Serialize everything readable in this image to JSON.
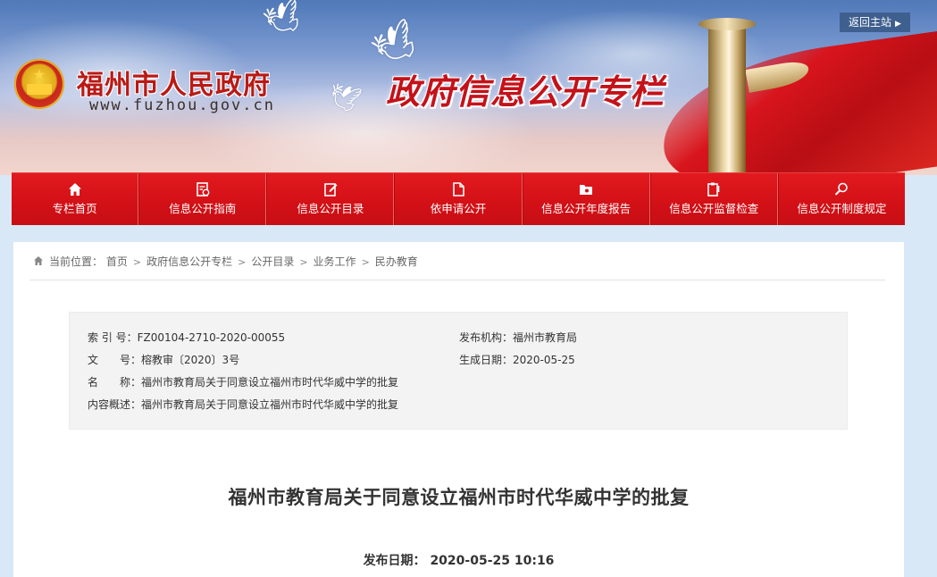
{
  "header": {
    "site_name": "福州市人民政府",
    "site_url": "www.fuzhou.gov.cn",
    "column_title": "政府信息公开专栏",
    "return_label": "返回主站"
  },
  "nav": {
    "items": [
      {
        "label": "专栏首页",
        "icon": "home-icon"
      },
      {
        "label": "信息公开指南",
        "icon": "guide-icon"
      },
      {
        "label": "信息公开目录",
        "icon": "catalog-icon"
      },
      {
        "label": "依申请公开",
        "icon": "document-icon"
      },
      {
        "label": "信息公开年度报告",
        "icon": "folder-icon"
      },
      {
        "label": "信息公开监督检查",
        "icon": "clipboard-icon"
      },
      {
        "label": "信息公开制度规定",
        "icon": "magnifier-icon"
      }
    ]
  },
  "breadcrumb": {
    "prefix": "当前位置：",
    "items": [
      "首页",
      "政府信息公开专栏",
      "公开目录",
      "业务工作",
      "民办教育"
    ],
    "separator": ">"
  },
  "meta": {
    "index_label": "索 引 号：",
    "index_value": "FZ00104-2710-2020-00055",
    "publisher_label": "发布机构：",
    "publisher_value": "福州市教育局",
    "docno_label": "文　　号：",
    "docno_value": "榕教审〔2020〕3号",
    "created_label": "生成日期：",
    "created_value": "2020-05-25",
    "name_label": "名　　称：",
    "name_value": "福州市教育局关于同意设立福州市时代华威中学的批复",
    "summary_label": "内容概述：",
    "summary_value": "福州市教育局关于同意设立福州市时代华威中学的批复"
  },
  "article": {
    "title": "福州市教育局关于同意设立福州市时代华威中学的批复",
    "pub_label": "发布日期：",
    "pub_value": "2020-05-25 10:16"
  },
  "colors": {
    "nav_red": "#d41218",
    "title_red": "#c4121a",
    "page_bg": "#d9e8f6"
  }
}
